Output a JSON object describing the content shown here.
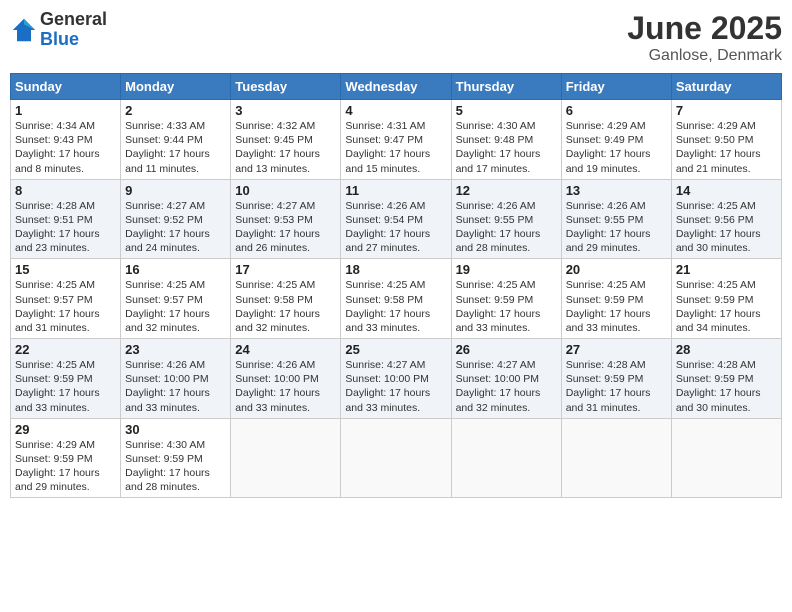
{
  "logo": {
    "general": "General",
    "blue": "Blue"
  },
  "title": "June 2025",
  "location": "Ganlose, Denmark",
  "days_header": [
    "Sunday",
    "Monday",
    "Tuesday",
    "Wednesday",
    "Thursday",
    "Friday",
    "Saturday"
  ],
  "weeks": [
    [
      {
        "day": "1",
        "sunrise": "4:34 AM",
        "sunset": "9:43 PM",
        "daylight": "17 hours and 8 minutes."
      },
      {
        "day": "2",
        "sunrise": "4:33 AM",
        "sunset": "9:44 PM",
        "daylight": "17 hours and 11 minutes."
      },
      {
        "day": "3",
        "sunrise": "4:32 AM",
        "sunset": "9:45 PM",
        "daylight": "17 hours and 13 minutes."
      },
      {
        "day": "4",
        "sunrise": "4:31 AM",
        "sunset": "9:47 PM",
        "daylight": "17 hours and 15 minutes."
      },
      {
        "day": "5",
        "sunrise": "4:30 AM",
        "sunset": "9:48 PM",
        "daylight": "17 hours and 17 minutes."
      },
      {
        "day": "6",
        "sunrise": "4:29 AM",
        "sunset": "9:49 PM",
        "daylight": "17 hours and 19 minutes."
      },
      {
        "day": "7",
        "sunrise": "4:29 AM",
        "sunset": "9:50 PM",
        "daylight": "17 hours and 21 minutes."
      }
    ],
    [
      {
        "day": "8",
        "sunrise": "4:28 AM",
        "sunset": "9:51 PM",
        "daylight": "17 hours and 23 minutes."
      },
      {
        "day": "9",
        "sunrise": "4:27 AM",
        "sunset": "9:52 PM",
        "daylight": "17 hours and 24 minutes."
      },
      {
        "day": "10",
        "sunrise": "4:27 AM",
        "sunset": "9:53 PM",
        "daylight": "17 hours and 26 minutes."
      },
      {
        "day": "11",
        "sunrise": "4:26 AM",
        "sunset": "9:54 PM",
        "daylight": "17 hours and 27 minutes."
      },
      {
        "day": "12",
        "sunrise": "4:26 AM",
        "sunset": "9:55 PM",
        "daylight": "17 hours and 28 minutes."
      },
      {
        "day": "13",
        "sunrise": "4:26 AM",
        "sunset": "9:55 PM",
        "daylight": "17 hours and 29 minutes."
      },
      {
        "day": "14",
        "sunrise": "4:25 AM",
        "sunset": "9:56 PM",
        "daylight": "17 hours and 30 minutes."
      }
    ],
    [
      {
        "day": "15",
        "sunrise": "4:25 AM",
        "sunset": "9:57 PM",
        "daylight": "17 hours and 31 minutes."
      },
      {
        "day": "16",
        "sunrise": "4:25 AM",
        "sunset": "9:57 PM",
        "daylight": "17 hours and 32 minutes."
      },
      {
        "day": "17",
        "sunrise": "4:25 AM",
        "sunset": "9:58 PM",
        "daylight": "17 hours and 32 minutes."
      },
      {
        "day": "18",
        "sunrise": "4:25 AM",
        "sunset": "9:58 PM",
        "daylight": "17 hours and 33 minutes."
      },
      {
        "day": "19",
        "sunrise": "4:25 AM",
        "sunset": "9:59 PM",
        "daylight": "17 hours and 33 minutes."
      },
      {
        "day": "20",
        "sunrise": "4:25 AM",
        "sunset": "9:59 PM",
        "daylight": "17 hours and 33 minutes."
      },
      {
        "day": "21",
        "sunrise": "4:25 AM",
        "sunset": "9:59 PM",
        "daylight": "17 hours and 34 minutes."
      }
    ],
    [
      {
        "day": "22",
        "sunrise": "4:25 AM",
        "sunset": "9:59 PM",
        "daylight": "17 hours and 33 minutes."
      },
      {
        "day": "23",
        "sunrise": "4:26 AM",
        "sunset": "10:00 PM",
        "daylight": "17 hours and 33 minutes."
      },
      {
        "day": "24",
        "sunrise": "4:26 AM",
        "sunset": "10:00 PM",
        "daylight": "17 hours and 33 minutes."
      },
      {
        "day": "25",
        "sunrise": "4:27 AM",
        "sunset": "10:00 PM",
        "daylight": "17 hours and 33 minutes."
      },
      {
        "day": "26",
        "sunrise": "4:27 AM",
        "sunset": "10:00 PM",
        "daylight": "17 hours and 32 minutes."
      },
      {
        "day": "27",
        "sunrise": "4:28 AM",
        "sunset": "9:59 PM",
        "daylight": "17 hours and 31 minutes."
      },
      {
        "day": "28",
        "sunrise": "4:28 AM",
        "sunset": "9:59 PM",
        "daylight": "17 hours and 30 minutes."
      }
    ],
    [
      {
        "day": "29",
        "sunrise": "4:29 AM",
        "sunset": "9:59 PM",
        "daylight": "17 hours and 29 minutes."
      },
      {
        "day": "30",
        "sunrise": "4:30 AM",
        "sunset": "9:59 PM",
        "daylight": "17 hours and 28 minutes."
      },
      null,
      null,
      null,
      null,
      null
    ]
  ],
  "labels": {
    "sunrise": "Sunrise:",
    "sunset": "Sunset:",
    "daylight": "Daylight:"
  }
}
